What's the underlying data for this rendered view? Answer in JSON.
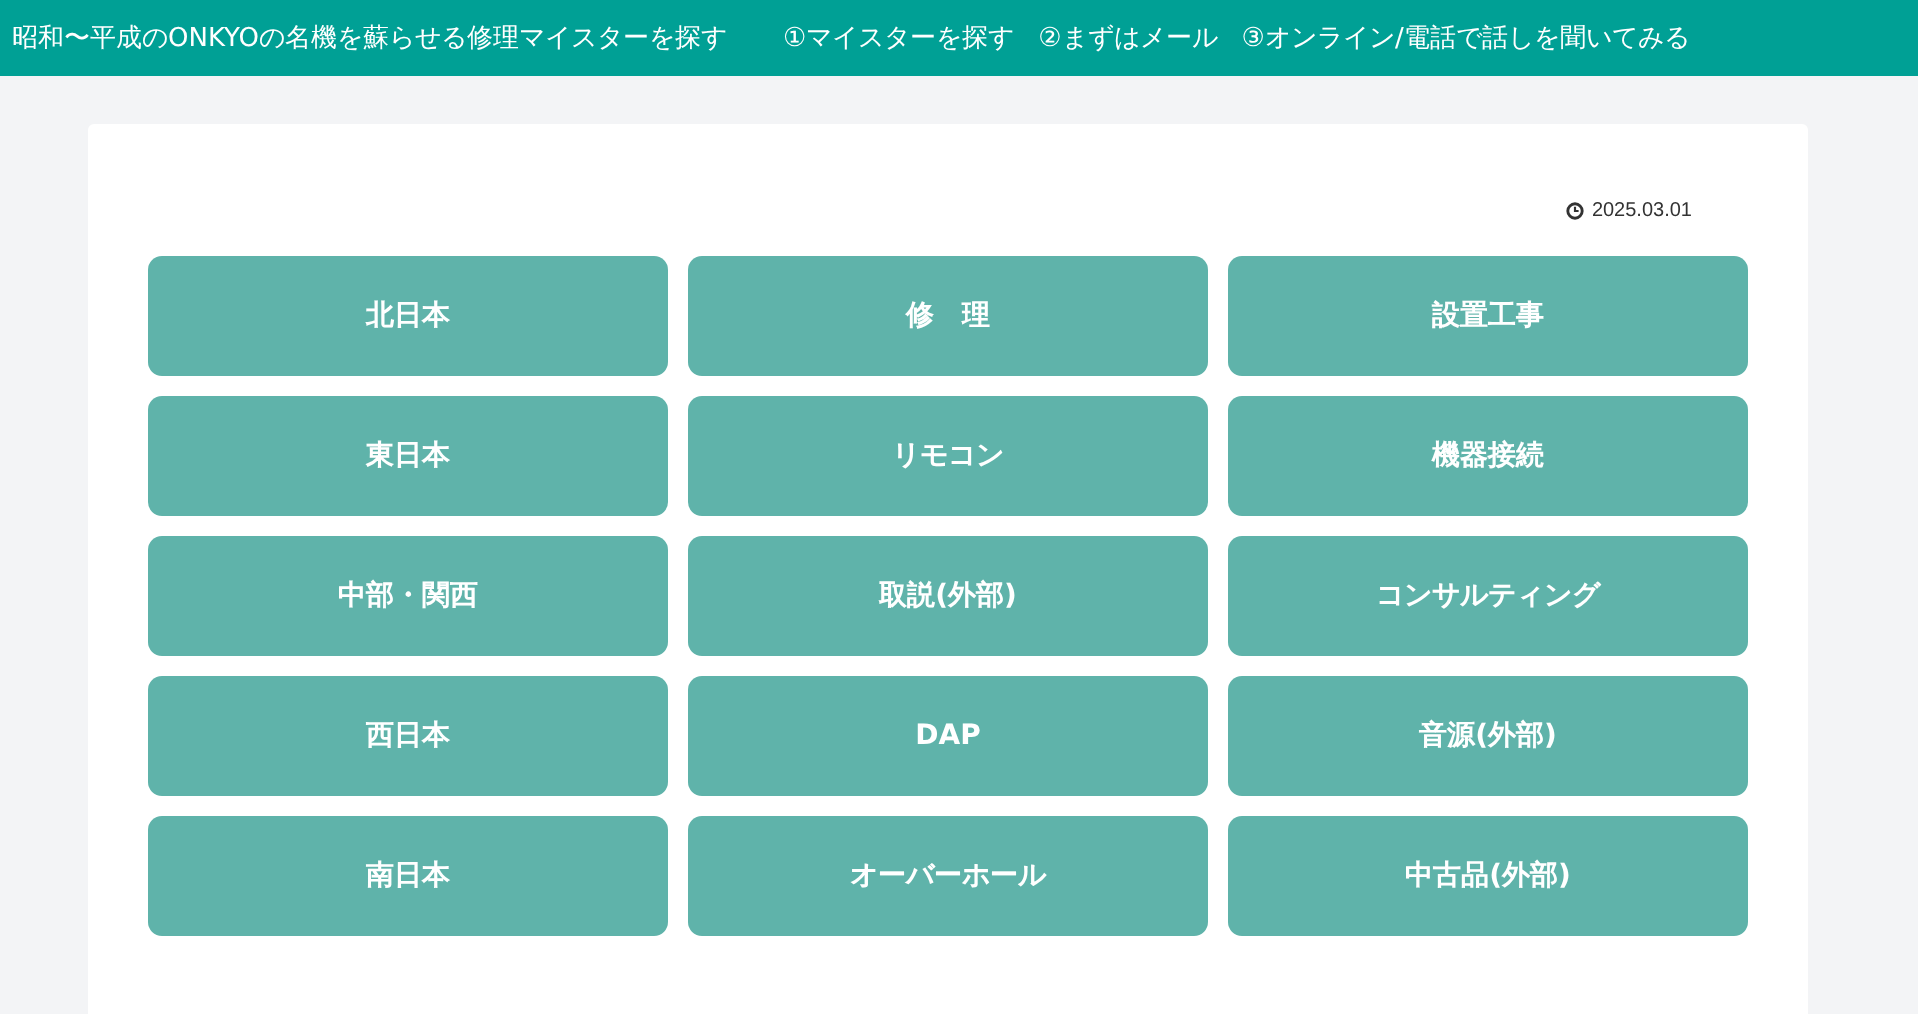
{
  "header": {
    "title": "昭和〜平成のONKYOの名機を蘇らせる修理マイスターを探す",
    "nav": [
      "①マイスターを探す",
      "②まずはメール",
      "③オンライン/電話で話しを聞いてみる"
    ]
  },
  "post": {
    "date": "2025.03.01",
    "buttons": [
      "北日本",
      "修　理",
      "設置工事",
      "東日本",
      "リモコン",
      "機器接続",
      "中部・関西",
      "取説(外部)",
      "コンサルティング",
      "西日本",
      "DAP",
      "音源(外部)",
      "南日本",
      "オーバーホール",
      "中古品(外部)"
    ]
  }
}
